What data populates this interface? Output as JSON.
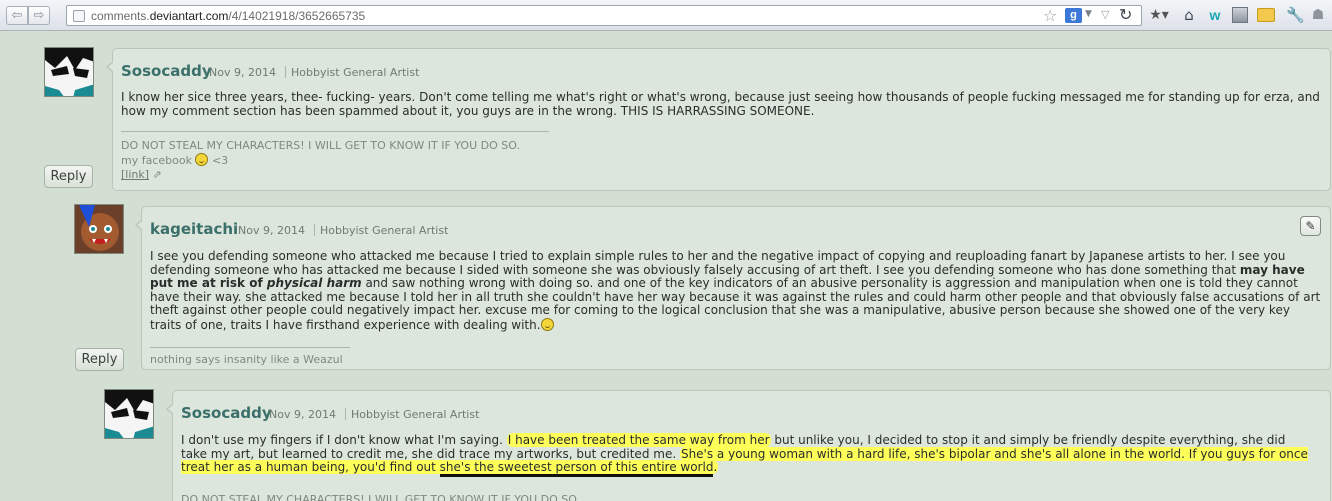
{
  "browser": {
    "back_glyph": "⇦",
    "forward_glyph": "⇨",
    "url_path_prefix": "comments.",
    "url_domain": "deviantart.com",
    "url_path": "/4/14021918/3652665735",
    "search_engine_glyph": "g"
  },
  "icons": {
    "star": "star-icon",
    "reload": "reload-icon",
    "home": "home-icon",
    "wrench": "wrench-icon"
  },
  "comments": [
    {
      "username": "Sosocaddy",
      "date": "Nov 9, 2014",
      "role": "Hobbyist General Artist",
      "body": "I know her sice three years, thee- fucking- years. Don't come telling me what's right or what's wrong, because just seeing how thousands of people fucking messaged me for standing up for erza, and how my comment section has been spammed about it, you guys are in the wrong. THIS IS HARRASSING SOMEONE.",
      "sig_line1": "DO NOT STEAL MY CHARACTERS! I WILL GET TO KNOW IT IF YOU DO SO.",
      "sig_line2_a": "my facebook",
      "sig_line2_b": "<3",
      "sig_link": "[link]",
      "reply_label": "Reply"
    },
    {
      "username": "kageitachi",
      "date": "Nov 9, 2014",
      "role": "Hobbyist General Artist",
      "body_p1": "I see you defending someone who attacked me because I tried to explain simple rules to her and the negative impact of copying and reuploading fanart by Japanese artists to her. I see you defending someone who has attacked me because I sided with someone she was obviously falsely accusing of art theft. I see you defending someone who has done something that ",
      "body_bold": "may have put me at risk of ",
      "body_bold_italic": "physical harm",
      "body_p2": " and saw nothing wrong with doing so. and one of the key indicators of an abusive personality is aggression and manipulation when one is told they cannot have their way. she attacked me because I told her in all truth she couldn't have her way because it was against the rules and could harm other people and that obviously false accusations of art theft against other people could negatively impact her. excuse me for coming to the logical conclusion that she was a manipulative, abusive person because she showed one of the very key traits of one, traits I have firsthand experience with dealing with.",
      "sig": "nothing says insanity like a Weazul",
      "reply_label": "Reply",
      "edit_glyph": "✎"
    },
    {
      "username": "Sosocaddy",
      "date": "Nov 9, 2014",
      "role": "Hobbyist General Artist",
      "body_a": "I don't use my fingers if I don't know what I'm saying. ",
      "body_hl1": "I have been treated the same way from her",
      "body_b": " but unlike you, I decided to stop it and simply be friendly despite everything, she did take my art, but learned to credit me, she did trace my artworks, but credited me. ",
      "body_hl2a": "She's a young woman with a hard life, she's bipolar and she's all alone in the world. If you guys for once treat her as a human being, you'd find out ",
      "body_hl2u": "she's the sweetest person of this entire world",
      "body_hl2end": ".",
      "sig_line1": "DO NOT STEAL MY CHARACTERS! I WILL GET TO KNOW IT IF YOU DO SO."
    }
  ]
}
